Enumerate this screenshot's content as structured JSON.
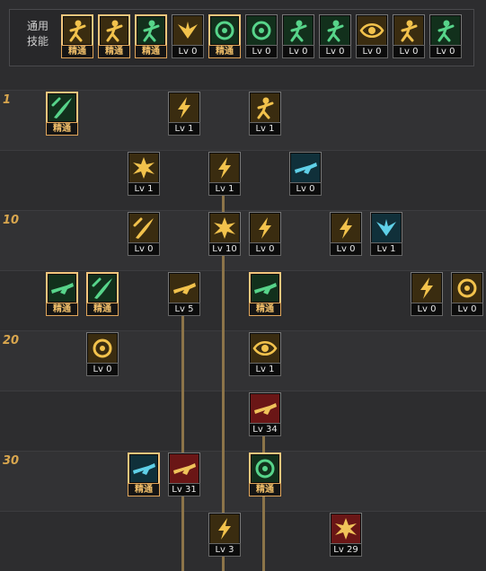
{
  "common_skills": {
    "label": "通用\n技能",
    "items": [
      {
        "id": "sit-skill",
        "icon": "sitting-figure-icon",
        "badge": "精通",
        "mastery": true,
        "theme": "gold"
      },
      {
        "id": "fall-skill",
        "icon": "tumbling-figure-icon",
        "badge": "精通",
        "mastery": true,
        "theme": "gold"
      },
      {
        "id": "dash-skill",
        "icon": "running-figure-icon",
        "badge": "精通",
        "mastery": true,
        "theme": "green"
      },
      {
        "id": "wings-skill",
        "icon": "wings-icon",
        "badge": "Lv 0",
        "mastery": false,
        "theme": "gold"
      },
      {
        "id": "target-skill",
        "icon": "crosshair-icon",
        "badge": "精通",
        "mastery": true,
        "theme": "green"
      },
      {
        "id": "radar-skill",
        "icon": "radar-icon",
        "badge": "Lv 0",
        "mastery": false,
        "theme": "green"
      },
      {
        "id": "cast-skill",
        "icon": "casting-figure-icon",
        "badge": "Lv 0",
        "mastery": false,
        "theme": "green"
      },
      {
        "id": "gear-skill",
        "icon": "gear-figure-icon",
        "badge": "Lv 0",
        "mastery": false,
        "theme": "green"
      },
      {
        "id": "eye-skill",
        "icon": "eye-icon",
        "badge": "Lv 0",
        "mastery": false,
        "theme": "gold"
      },
      {
        "id": "flex-skill",
        "icon": "flexing-figure-icon",
        "badge": "Lv 0",
        "mastery": false,
        "theme": "gold"
      },
      {
        "id": "stance-skill",
        "icon": "standing-figure-icon",
        "badge": "Lv 0",
        "mastery": false,
        "theme": "green"
      }
    ]
  },
  "level_markers": [
    "1",
    "10",
    "20",
    "30"
  ],
  "tree_skills": [
    {
      "id": "kick-skill",
      "icon": "kick-icon",
      "badge": "精通",
      "mastery": true,
      "theme": "green"
    },
    {
      "id": "uppercut-skill",
      "icon": "uppercut-icon",
      "badge": "Lv 1",
      "mastery": false,
      "theme": "gold"
    },
    {
      "id": "throw-skill",
      "icon": "throw-icon",
      "badge": "Lv 1",
      "mastery": false,
      "theme": "gold"
    },
    {
      "id": "explosion-skill",
      "icon": "explosion-icon",
      "badge": "Lv 1",
      "mastery": false,
      "theme": "gold"
    },
    {
      "id": "burst-shot-skill",
      "icon": "burst-shot-icon",
      "badge": "Lv 1",
      "mastery": false,
      "theme": "gold"
    },
    {
      "id": "drone-skill",
      "icon": "drone-icon",
      "badge": "Lv 0",
      "mastery": false,
      "theme": "cyan"
    },
    {
      "id": "slash-skill",
      "icon": "slash-icon",
      "badge": "Lv 0",
      "mastery": false,
      "theme": "gold"
    },
    {
      "id": "blast-skill",
      "icon": "blast-icon",
      "badge": "Lv 10",
      "mastery": false,
      "theme": "gold"
    },
    {
      "id": "beam-skill",
      "icon": "beam-icon",
      "badge": "Lv 0",
      "mastery": false,
      "theme": "gold"
    },
    {
      "id": "lift-skill",
      "icon": "lift-icon",
      "badge": "Lv 0",
      "mastery": false,
      "theme": "gold"
    },
    {
      "id": "claw-skill",
      "icon": "claw-icon",
      "badge": "Lv 1",
      "mastery": false,
      "theme": "cyan"
    },
    {
      "id": "rifle-skill",
      "icon": "rifle-icon",
      "badge": "精通",
      "mastery": true,
      "theme": "green"
    },
    {
      "id": "blade-skill",
      "icon": "blade-icon",
      "badge": "精通",
      "mastery": true,
      "theme": "green"
    },
    {
      "id": "slide-skill",
      "icon": "slide-icon",
      "badge": "Lv 5",
      "mastery": false,
      "theme": "gold"
    },
    {
      "id": "grenade-launch-skill",
      "icon": "grenade-launch-icon",
      "badge": "精通",
      "mastery": true,
      "theme": "green"
    },
    {
      "id": "hammer-skill",
      "icon": "hammer-icon",
      "badge": "Lv 0",
      "mastery": false,
      "theme": "gold"
    },
    {
      "id": "grenade-skill",
      "icon": "grenade-icon",
      "badge": "Lv 0",
      "mastery": false,
      "theme": "gold"
    },
    {
      "id": "spin-skill",
      "icon": "spin-icon",
      "badge": "Lv 0",
      "mastery": false,
      "theme": "gold"
    },
    {
      "id": "vision-skill",
      "icon": "vision-icon",
      "badge": "Lv 1",
      "mastery": false,
      "theme": "gold"
    },
    {
      "id": "cannon-skill",
      "icon": "cannon-icon",
      "badge": "Lv 34",
      "mastery": false,
      "theme": "red"
    },
    {
      "id": "plasma-gun-skill",
      "icon": "plasma-gun-icon",
      "badge": "精通",
      "mastery": true,
      "theme": "cyan"
    },
    {
      "id": "missile-skill",
      "icon": "missile-icon",
      "badge": "Lv 31",
      "mastery": false,
      "theme": "red"
    },
    {
      "id": "satellite-skill",
      "icon": "satellite-icon",
      "badge": "精通",
      "mastery": true,
      "theme": "green"
    },
    {
      "id": "barrage-skill",
      "icon": "barrage-icon",
      "badge": "Lv 3",
      "mastery": false,
      "theme": "gold"
    },
    {
      "id": "tornado-skill",
      "icon": "tornado-icon",
      "badge": "Lv 29",
      "mastery": false,
      "theme": "red"
    }
  ],
  "themes": {
    "gold": {
      "bg": "#3a2c10",
      "fg": "#f2c24c"
    },
    "green": {
      "bg": "#12301c",
      "fg": "#57d48a"
    },
    "cyan": {
      "bg": "#10303a",
      "fg": "#5fd0e8"
    },
    "red": {
      "bg": "#6a1616",
      "fg": "#f0c35a"
    }
  }
}
